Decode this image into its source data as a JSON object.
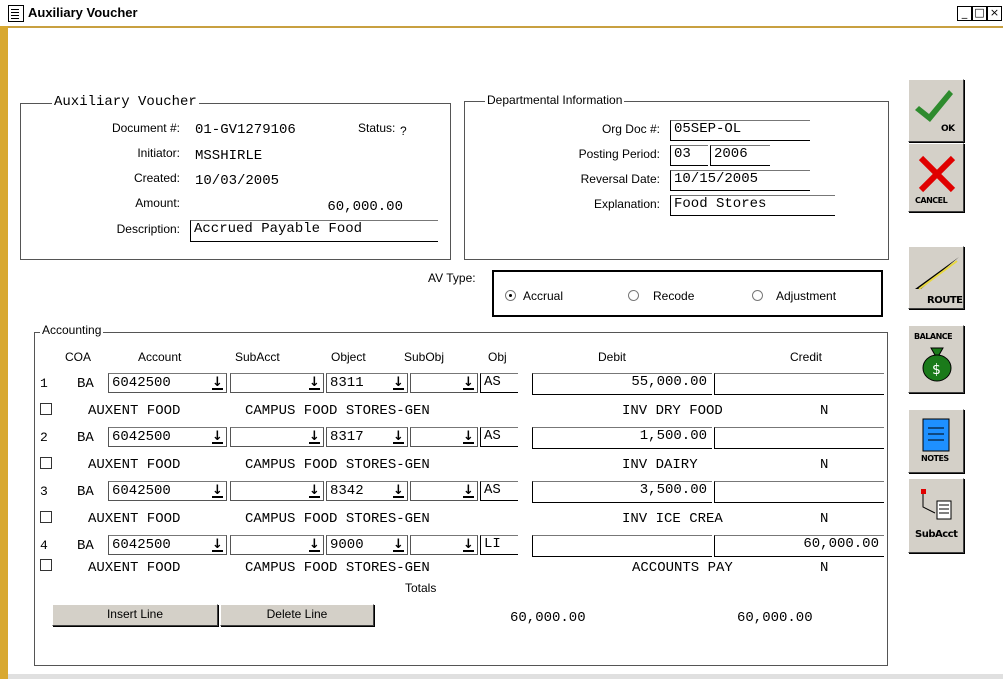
{
  "window": {
    "title": "Auxiliary Voucher",
    "controls": {
      "minimize": "_",
      "maximize": "□",
      "close": "×"
    }
  },
  "document_group": {
    "legend": "Auxiliary Voucher",
    "document_label": "Document #:",
    "document_value": "01-GV1279106",
    "status_label": "Status:",
    "status_value": "?",
    "initiator_label": "Initiator:",
    "initiator_value": "MSSHIRLE",
    "created_label": "Created:",
    "created_value": "10/03/2005",
    "amount_label": "Amount:",
    "amount_value": "60,000.00",
    "description_label": "Description:",
    "description_value": "Accrued Payable Food"
  },
  "dept_group": {
    "legend": "Departmental Information",
    "orgdoc_label": "Org Doc #:",
    "orgdoc_value": "05SEP-OL",
    "period_label": "Posting Period:",
    "period_month": "03",
    "period_year": "2006",
    "reversal_label": "Reversal Date:",
    "reversal_value": "10/15/2005",
    "explanation_label": "Explanation:",
    "explanation_value": "Food Stores"
  },
  "av_type": {
    "label": "AV Type:",
    "options": [
      "Accrual",
      "Recode",
      "Adjustment"
    ],
    "selected": "Accrual"
  },
  "accounting": {
    "legend": "Accounting",
    "headers": {
      "coa": "COA",
      "account": "Account",
      "subacct": "SubAcct",
      "object": "Object",
      "subobj": "SubObj",
      "obj": "Obj",
      "debit": "Debit",
      "credit": "Credit"
    },
    "lines": [
      {
        "num": "1",
        "coa": "BA",
        "account": "6042500",
        "subacct": "",
        "object": "8311",
        "subobj": "",
        "obj": "AS",
        "debit": "55,000.00",
        "credit": "",
        "acct_desc": "AUXENT FOOD",
        "org_desc": "CAMPUS FOOD STORES-GEN",
        "obj_desc": "INV DRY FOOD",
        "flag": "N"
      },
      {
        "num": "2",
        "coa": "BA",
        "account": "6042500",
        "subacct": "",
        "object": "8317",
        "subobj": "",
        "obj": "AS",
        "debit": "1,500.00",
        "credit": "",
        "acct_desc": "AUXENT FOOD",
        "org_desc": "CAMPUS FOOD STORES-GEN",
        "obj_desc": "INV DAIRY",
        "flag": "N"
      },
      {
        "num": "3",
        "coa": "BA",
        "account": "6042500",
        "subacct": "",
        "object": "8342",
        "subobj": "",
        "obj": "AS",
        "debit": "3,500.00",
        "credit": "",
        "acct_desc": "AUXENT FOOD",
        "org_desc": "CAMPUS FOOD STORES-GEN",
        "obj_desc": "INV ICE CREA",
        "flag": "N"
      },
      {
        "num": "4",
        "coa": "BA",
        "account": "6042500",
        "subacct": "",
        "object": "9000",
        "subobj": "",
        "obj": "LI",
        "debit": "",
        "credit": "60,000.00",
        "acct_desc": "AUXENT FOOD",
        "org_desc": "CAMPUS FOOD STORES-GEN",
        "obj_desc": "ACCOUNTS PAY",
        "flag": "N"
      }
    ],
    "totals_label": "Totals",
    "total_debit": "60,000.00",
    "total_credit": "60,000.00",
    "insert_label": "Insert Line",
    "delete_label": "Delete Line"
  },
  "toolbar": {
    "ok_label": "OK",
    "cancel_label": "CANCEL",
    "route_label": "ROUTE",
    "balance_label": "BALANCE",
    "notes_label": "NOTES",
    "subacct_label": "SubAcct",
    "colors": {
      "ok": "#2e8b2e",
      "cancel": "#e00000",
      "balance": "#1a7a1a",
      "notes": "#1e90ff"
    }
  }
}
